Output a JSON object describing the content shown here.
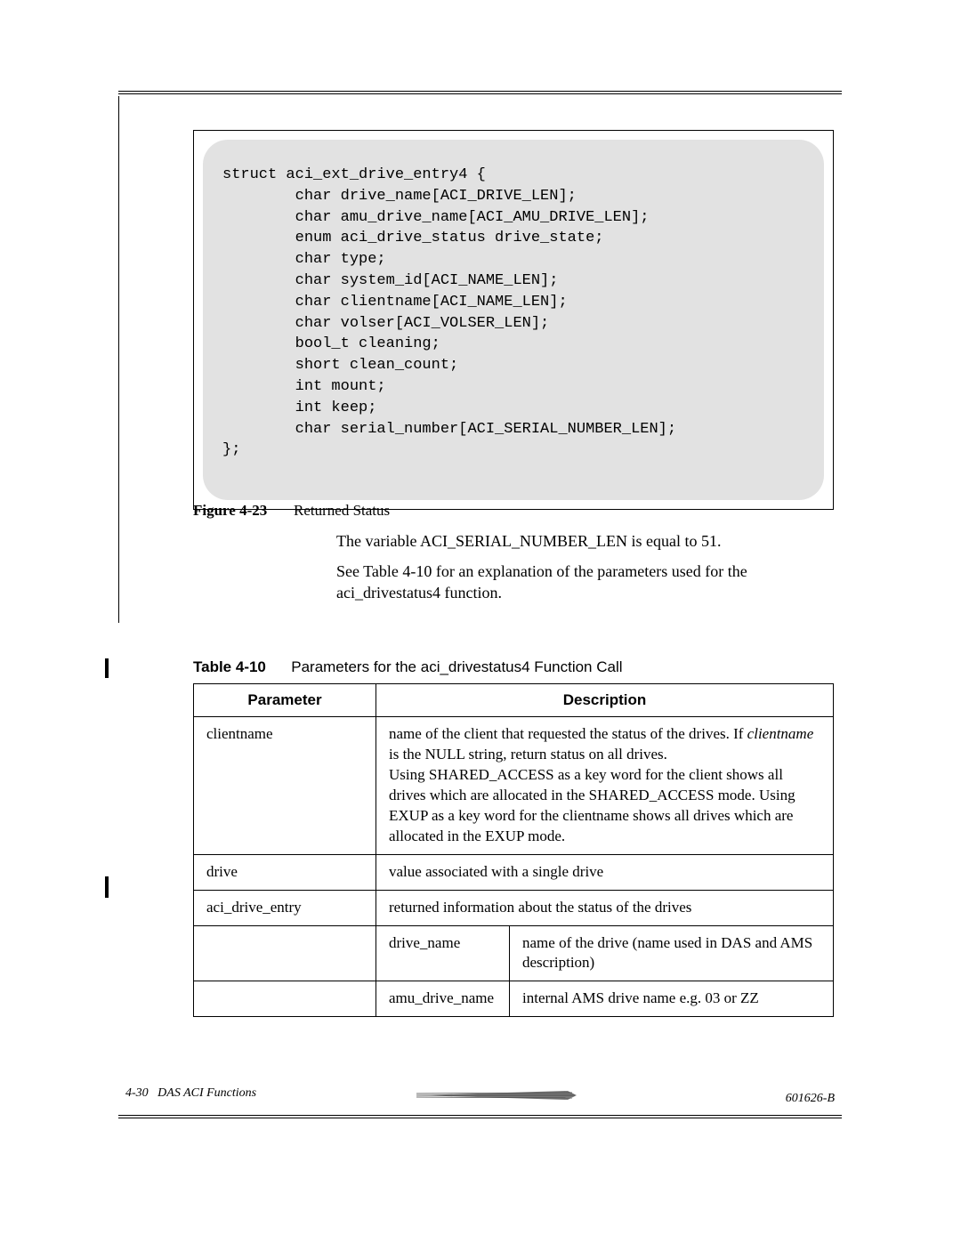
{
  "code_block": "struct aci_ext_drive_entry4 {\n        char drive_name[ACI_DRIVE_LEN];\n        char amu_drive_name[ACI_AMU_DRIVE_LEN];\n        enum aci_drive_status drive_state;\n        char type;\n        char system_id[ACI_NAME_LEN];\n        char clientname[ACI_NAME_LEN];\n        char volser[ACI_VOLSER_LEN];\n        bool_t cleaning;\n        short clean_count;\n        int mount;\n        int keep;\n        char serial_number[ACI_SERIAL_NUMBER_LEN];\n};",
  "figure": {
    "label": "Figure 4-23",
    "title": "Returned Status"
  },
  "paragraphs": {
    "p1": "The variable ACI_SERIAL_NUMBER_LEN is equal to 51.",
    "p2": "See Table 4-10   for an explanation of the parameters used for the aci_drivestatus4 function."
  },
  "table_caption": {
    "label": "Table 4-10",
    "title": "Parameters for the aci_drivestatus4 Function Call"
  },
  "table": {
    "headers": {
      "col1": "Parameter",
      "col2": "Description"
    },
    "rows": {
      "r1": {
        "param": "clientname",
        "desc_pre": "name of the client that requested the status of the drives. If ",
        "desc_italic": "clientname",
        "desc_post": " is the NULL string, return status on all drives.\nUsing SHARED_ACCESS as a key word for the client shows all drives which are allocated in the SHARED_ACCESS mode. Using EXUP as a key word for the clientname shows all drives which are allocated in the EXUP mode."
      },
      "r2": {
        "param": "drive",
        "desc": "value associated with a single drive"
      },
      "r3": {
        "param": "aci_drive_entry",
        "desc": "returned information about the status of the drives"
      },
      "r4": {
        "sub1": "drive_name",
        "sub2": "name of the drive (name used in DAS and AMS description)"
      },
      "r5": {
        "sub1": "amu_drive_name",
        "sub2": "internal AMS drive name e.g. 03 or ZZ"
      }
    }
  },
  "footer": {
    "left_page": "4-30",
    "left_title": "DAS ACI Functions",
    "right": "601626-B"
  }
}
